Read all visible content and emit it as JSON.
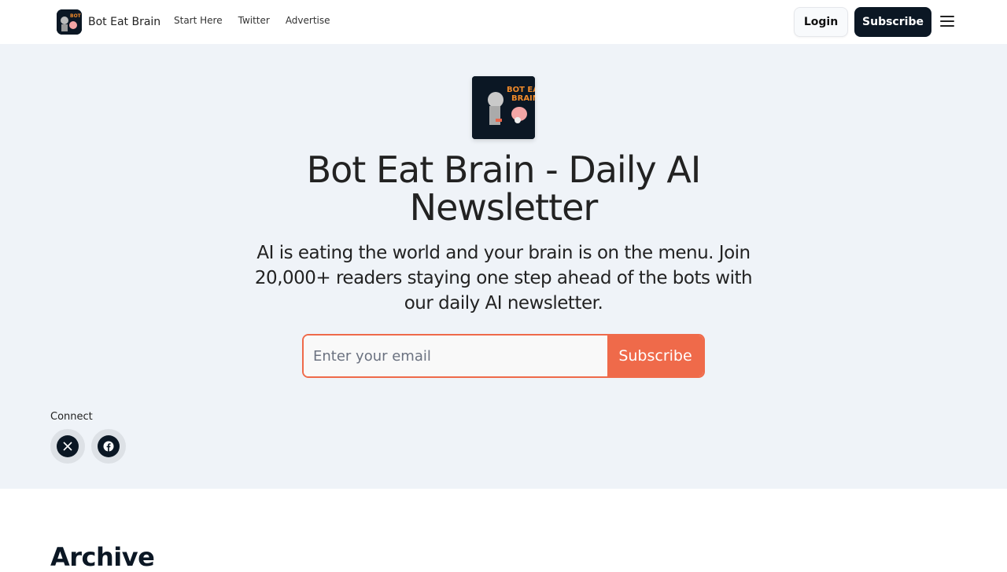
{
  "header": {
    "brand_name": "Bot Eat Brain",
    "nav": [
      "Start Here",
      "Twitter",
      "Advertise"
    ],
    "login_label": "Login",
    "subscribe_label": "Subscribe",
    "menu_icon": "hamburger-menu-icon"
  },
  "hero": {
    "logo_text": "BOT EAT BRAIN",
    "title": "Bot Eat Brain - Daily AI Newsletter",
    "description": "AI is eating the world and your brain is on the menu. Join 20,000+ readers staying one step ahead of the bots with our daily AI newsletter.",
    "email_placeholder": "Enter your email",
    "email_value": "",
    "subscribe_label": "Subscribe"
  },
  "connect": {
    "label": "Connect",
    "socials": [
      {
        "name": "X",
        "icon": "x-twitter-icon",
        "glyph": "𝕏"
      },
      {
        "name": "Facebook",
        "icon": "facebook-icon",
        "glyph": "f"
      }
    ]
  },
  "archive": {
    "title": "Archive"
  },
  "colors": {
    "accent": "#ef6a4a",
    "dark": "#0b1724",
    "hero_bg": "#eff3f8"
  }
}
